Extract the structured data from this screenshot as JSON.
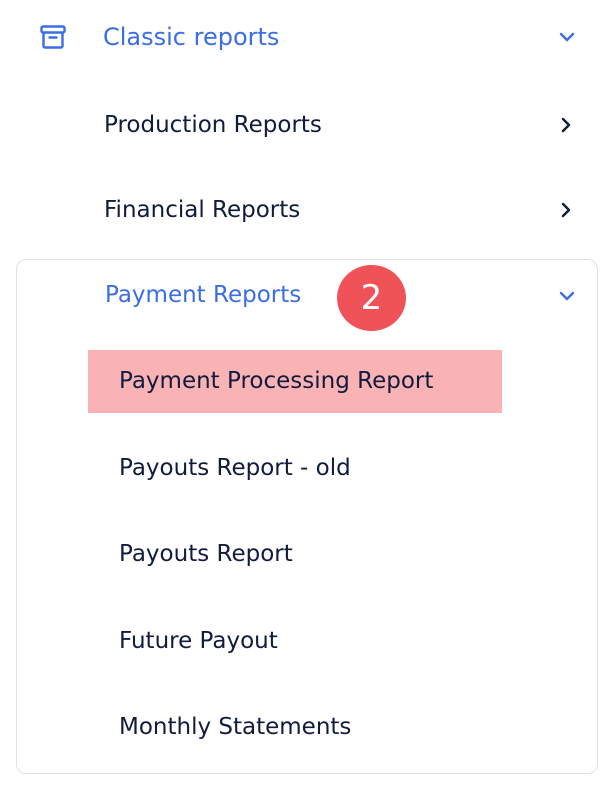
{
  "colors": {
    "accent": "#3b6de4",
    "text": "#121b3d",
    "highlight": "#f9b3b5",
    "badge": "#ef5358",
    "border": "#dfe1e6"
  },
  "section": {
    "title": "Classic reports",
    "icon": "archive-icon",
    "toggle_icon": "chevron-down-icon"
  },
  "menu": [
    {
      "label": "Production Reports",
      "icon": "chevron-right-icon"
    },
    {
      "label": "Financial Reports",
      "icon": "chevron-right-icon"
    }
  ],
  "payment": {
    "label": "Payment Reports",
    "step_badge": "2",
    "toggle_icon": "chevron-down-icon",
    "items": [
      {
        "label": "Payment Processing Report",
        "highlighted": true
      },
      {
        "label": "Payouts Report - old"
      },
      {
        "label": "Payouts Report"
      },
      {
        "label": "Future Payout"
      },
      {
        "label": "Monthly Statements"
      }
    ]
  }
}
